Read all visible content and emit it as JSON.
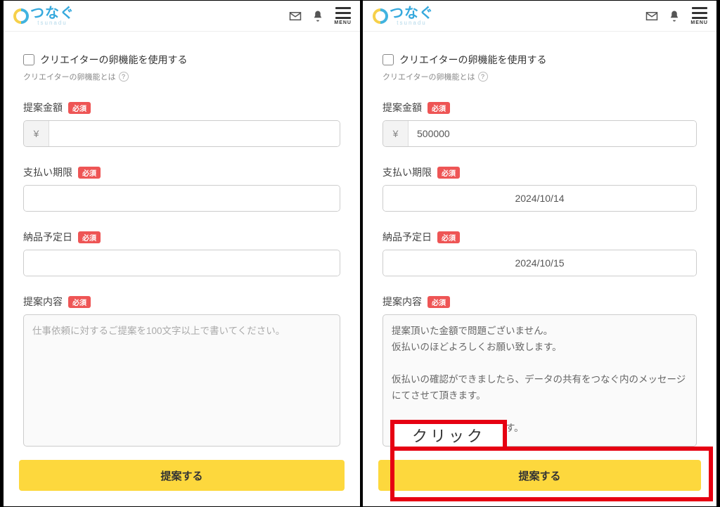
{
  "header": {
    "logo_main": "つなぐ",
    "logo_sub": "tsunadu",
    "menu_label": "MENU"
  },
  "left": {
    "egg_checkbox_label": "クリエイターの卵機能を使用する",
    "egg_helper": "クリエイターの卵機能とは",
    "egg_help_icon": "?",
    "required_badge": "必須",
    "amount_label": "提案金額",
    "yen_symbol": "¥",
    "amount_value": "",
    "deadline_label": "支払い期限",
    "deadline_value": "",
    "delivery_label": "納品予定日",
    "delivery_value": "",
    "content_label": "提案内容",
    "content_placeholder": "仕事依頼に対するご提案を100文字以上で書いてください。",
    "content_value": "",
    "submit_label": "提案する"
  },
  "right": {
    "egg_checkbox_label": "クリエイターの卵機能を使用する",
    "egg_helper": "クリエイターの卵機能とは",
    "egg_help_icon": "?",
    "required_badge": "必須",
    "amount_label": "提案金額",
    "yen_symbol": "¥",
    "amount_value": "500000",
    "deadline_label": "支払い期限",
    "deadline_value": "2024/10/14",
    "delivery_label": "納品予定日",
    "delivery_value": "2024/10/15",
    "content_label": "提案内容",
    "content_value": "提案頂いた金額で問題ございません。\n仮払いのほどよろしくお願い致します。\n\n仮払いの確認ができましたら、データの共有をつなぐ内のメッセージにてさせて頂きます。\n\n以上よろしくお願い致します。",
    "submit_label": "提案する"
  },
  "annotation": {
    "click_label": "クリック"
  }
}
